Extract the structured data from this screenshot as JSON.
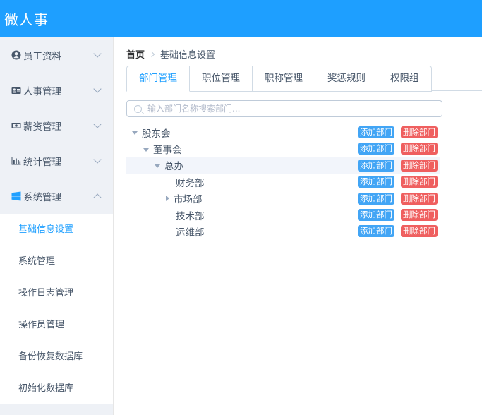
{
  "header": {
    "title": "微人事"
  },
  "sidebar": {
    "menus": [
      {
        "label": "员工资料",
        "icon": "user-circle-icon"
      },
      {
        "label": "人事管理",
        "icon": "id-card-icon"
      },
      {
        "label": "薪资管理",
        "icon": "money-icon"
      },
      {
        "label": "统计管理",
        "icon": "bar-chart-icon"
      },
      {
        "label": "系统管理",
        "icon": "windows-icon"
      }
    ],
    "submenu": [
      {
        "label": "基础信息设置"
      },
      {
        "label": "系统管理"
      },
      {
        "label": "操作日志管理"
      },
      {
        "label": "操作员管理"
      },
      {
        "label": "备份恢复数据库"
      },
      {
        "label": "初始化数据库"
      }
    ]
  },
  "breadcrumb": {
    "home": "首页",
    "current": "基础信息设置"
  },
  "tabs": [
    "部门管理",
    "职位管理",
    "职称管理",
    "奖惩规则",
    "权限组"
  ],
  "search": {
    "placeholder": "输入部门名称搜索部门..."
  },
  "tree": {
    "add_label": "添加部门",
    "delete_label": "删除部门",
    "nodes": [
      {
        "label": "股东会"
      },
      {
        "label": "董事会"
      },
      {
        "label": "总办"
      },
      {
        "label": "财务部"
      },
      {
        "label": "市场部"
      },
      {
        "label": "技术部"
      },
      {
        "label": "运维部"
      }
    ]
  },
  "colors": {
    "header": "#1e9fff",
    "active": "#20a0ff",
    "add": "#42a5f5",
    "delete": "#ef5f5f"
  }
}
